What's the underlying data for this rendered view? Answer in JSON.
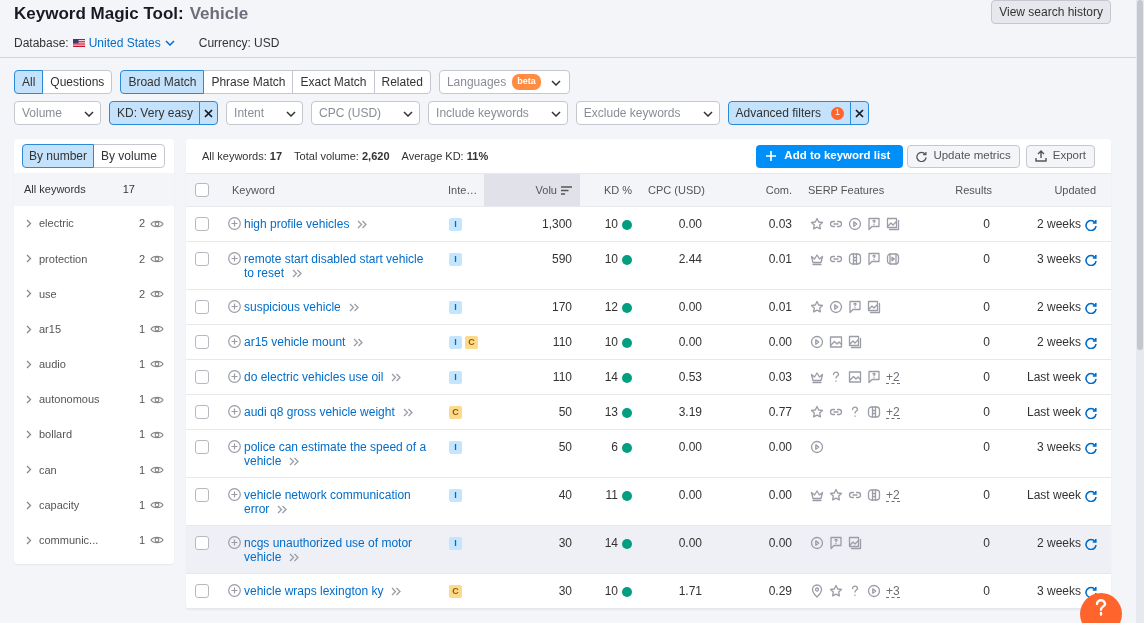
{
  "header": {
    "title": "Keyword Magic Tool:",
    "query": "Vehicle",
    "database_label": "Database:",
    "database": "United States",
    "currency": "Currency: USD",
    "history_button": "View search history"
  },
  "question_filter": [
    {
      "label": "All",
      "selected": true
    },
    {
      "label": "Questions",
      "selected": false
    }
  ],
  "match_type": [
    {
      "label": "Broad Match",
      "selected": true
    },
    {
      "label": "Phrase Match",
      "selected": false
    },
    {
      "label": "Exact Match",
      "selected": false
    },
    {
      "label": "Related",
      "selected": false
    }
  ],
  "languages": {
    "label": "Languages",
    "badge": "beta"
  },
  "filters": [
    {
      "label": "Volume",
      "active": false
    },
    {
      "label": "KD: Very easy",
      "active": true
    },
    {
      "label": "Intent",
      "active": false
    },
    {
      "label": "CPC (USD)",
      "active": false
    },
    {
      "label": "Include keywords",
      "active": false
    },
    {
      "label": "Exclude keywords",
      "active": false
    },
    {
      "label": "Advanced filters",
      "active": true,
      "count": "1"
    }
  ],
  "sidebar": {
    "sort_tabs": [
      {
        "label": "By number",
        "selected": true
      },
      {
        "label": "By volume",
        "selected": false
      }
    ],
    "all_label": "All keywords",
    "all_count": "17",
    "groups": [
      {
        "label": "electric",
        "count": "2"
      },
      {
        "label": "protection",
        "count": "2"
      },
      {
        "label": "use",
        "count": "2"
      },
      {
        "label": "ar15",
        "count": "1"
      },
      {
        "label": "audio",
        "count": "1"
      },
      {
        "label": "autonomous",
        "count": "1"
      },
      {
        "label": "bollard",
        "count": "1"
      },
      {
        "label": "can",
        "count": "1"
      },
      {
        "label": "capacity",
        "count": "1"
      },
      {
        "label": "communic...",
        "count": "1"
      }
    ]
  },
  "summary": [
    "All keywords: **17**",
    "Total volume: **2,620**",
    "Average KD: **11%**"
  ],
  "actions": {
    "add": "Add to keyword list",
    "update": "Update metrics",
    "export": "Export"
  },
  "table": {
    "select_all": {
      "checked": false
    },
    "columns": [
      {
        "label": "Keyword",
        "sorted": false
      },
      {
        "label": "Inte…",
        "sorted": false
      },
      {
        "label": "Volu",
        "sorted": true
      },
      {
        "label": "KD %",
        "sorted": false
      },
      {
        "label": "CPC (USD)",
        "sorted": false
      },
      {
        "label": "Com.",
        "sorted": false
      },
      {
        "label": "SERP Features",
        "sorted": false
      },
      {
        "label": "Results",
        "sorted": false
      },
      {
        "label": "Updated",
        "sorted": false
      }
    ],
    "rows": [
      {
        "keyword": "high profile vehicles",
        "intents": [
          {
            "label": "I",
            "kind": "informational"
          }
        ],
        "volume": "1,300",
        "kd": "10",
        "cpc": "0.00",
        "com": "0.03",
        "serp": [
          {
            "kind": "star"
          },
          {
            "kind": "link"
          },
          {
            "kind": "video"
          },
          {
            "kind": "review"
          },
          {
            "kind": "images"
          }
        ],
        "results": "0",
        "updated": "2 weeks",
        "checked": false,
        "hovered": false
      },
      {
        "keyword": "remote start disabled start vehicle to reset",
        "intents": [
          {
            "label": "I",
            "kind": "informational"
          }
        ],
        "volume": "590",
        "kd": "10",
        "cpc": "2.44",
        "com": "0.01",
        "serp": [
          {
            "kind": "crown"
          },
          {
            "kind": "link"
          },
          {
            "kind": "book"
          },
          {
            "kind": "review"
          },
          {
            "kind": "playbox"
          }
        ],
        "results": "0",
        "updated": "3 weeks",
        "checked": false,
        "hovered": false
      },
      {
        "keyword": "suspicious vehicle",
        "intents": [
          {
            "label": "I",
            "kind": "informational"
          }
        ],
        "volume": "170",
        "kd": "12",
        "cpc": "0.00",
        "com": "0.01",
        "serp": [
          {
            "kind": "star"
          },
          {
            "kind": "video"
          },
          {
            "kind": "review"
          },
          {
            "kind": "images"
          }
        ],
        "results": "0",
        "updated": "2 weeks",
        "checked": false,
        "hovered": false
      },
      {
        "keyword": "ar15 vehicle mount",
        "intents": [
          {
            "label": "I",
            "kind": "informational"
          },
          {
            "label": "C",
            "kind": "commercial"
          }
        ],
        "volume": "110",
        "kd": "10",
        "cpc": "0.00",
        "com": "0.00",
        "serp": [
          {
            "kind": "video"
          },
          {
            "kind": "image"
          },
          {
            "kind": "images"
          }
        ],
        "results": "0",
        "updated": "2 weeks",
        "checked": false,
        "hovered": false
      },
      {
        "keyword": "do electric vehicles use oil",
        "intents": [
          {
            "label": "I",
            "kind": "informational"
          }
        ],
        "volume": "110",
        "kd": "14",
        "cpc": "0.53",
        "com": "0.03",
        "serp": [
          {
            "kind": "crown"
          },
          {
            "kind": "question"
          },
          {
            "kind": "image"
          },
          {
            "kind": "review"
          }
        ],
        "serp_more": "+2",
        "results": "0",
        "updated": "Last week",
        "checked": false,
        "hovered": false
      },
      {
        "keyword": "audi q8 gross vehicle weight",
        "intents": [
          {
            "label": "C",
            "kind": "commercial"
          }
        ],
        "volume": "50",
        "kd": "13",
        "cpc": "3.19",
        "com": "0.77",
        "serp": [
          {
            "kind": "star"
          },
          {
            "kind": "link"
          },
          {
            "kind": "question"
          },
          {
            "kind": "book"
          }
        ],
        "serp_more": "+2",
        "results": "0",
        "updated": "Last week",
        "checked": false,
        "hovered": false
      },
      {
        "keyword": "police can estimate the speed of a vehicle",
        "intents": [
          {
            "label": "I",
            "kind": "informational"
          }
        ],
        "volume": "50",
        "kd": "6",
        "cpc": "0.00",
        "com": "0.00",
        "serp": [
          {
            "kind": "video"
          }
        ],
        "results": "0",
        "updated": "3 weeks",
        "checked": false,
        "hovered": false
      },
      {
        "keyword": "vehicle network communication error",
        "intents": [
          {
            "label": "I",
            "kind": "informational"
          }
        ],
        "volume": "40",
        "kd": "11",
        "cpc": "0.00",
        "com": "0.00",
        "serp": [
          {
            "kind": "crown"
          },
          {
            "kind": "star"
          },
          {
            "kind": "link"
          },
          {
            "kind": "book"
          }
        ],
        "serp_more": "+2",
        "results": "0",
        "updated": "Last week",
        "checked": false,
        "hovered": false
      },
      {
        "keyword": "ncgs unauthorized use of motor vehicle",
        "intents": [
          {
            "label": "I",
            "kind": "informational"
          }
        ],
        "volume": "30",
        "kd": "14",
        "cpc": "0.00",
        "com": "0.00",
        "serp": [
          {
            "kind": "video"
          },
          {
            "kind": "review"
          },
          {
            "kind": "images"
          }
        ],
        "results": "0",
        "updated": "2 weeks",
        "checked": false,
        "hovered": true
      },
      {
        "keyword": "vehicle wraps lexington ky",
        "intents": [
          {
            "label": "C",
            "kind": "commercial"
          }
        ],
        "volume": "30",
        "kd": "10",
        "cpc": "1.71",
        "com": "0.29",
        "serp": [
          {
            "kind": "pin"
          },
          {
            "kind": "star"
          },
          {
            "kind": "question"
          },
          {
            "kind": "video"
          }
        ],
        "serp_more": "+3",
        "results": "0",
        "updated": "3 weeks",
        "checked": false,
        "hovered": false
      }
    ]
  }
}
